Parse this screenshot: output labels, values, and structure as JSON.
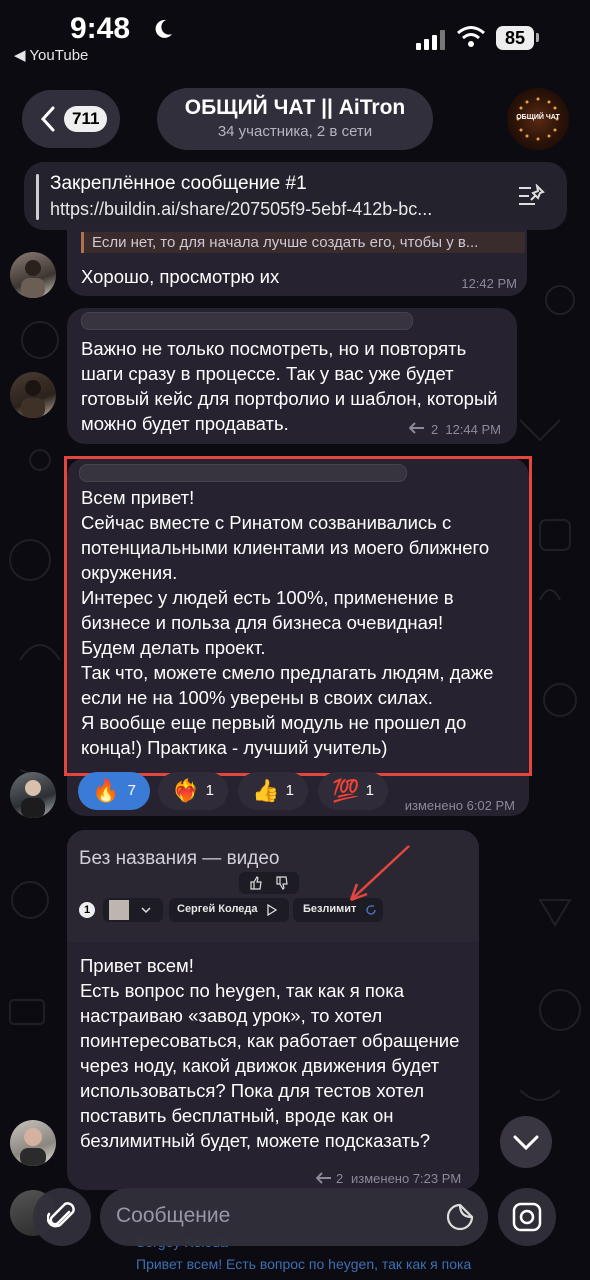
{
  "status_bar": {
    "time": "9:48",
    "back_app": "◀ YouTube",
    "battery": "85"
  },
  "header": {
    "back_count": "711",
    "title": "ОБЩИЙ ЧАТ || AiTron",
    "subtitle": "34 участника, 2 в сети",
    "avatar_text": "ОБЩИЙ ЧАТ"
  },
  "pinned": {
    "title": "Закреплённое сообщение #1",
    "text": "https://buildin.ai/share/207505f9-5ebf-412b-bc..."
  },
  "messages": [
    {
      "quote": "Если нет, то для начала лучше создать его, чтобы у в...",
      "text": "Хорошо, просмотрю их",
      "time": "12:42 PM"
    },
    {
      "text": "Важно не только посмотреть, но и повторять шаги сразу в процессе. Так у вас уже будет готовый кейс для портфолио и шаблон, который можно будет продавать.",
      "replies": "2",
      "time": "12:44 PM"
    },
    {
      "text": "Всем привет!\nСейчас вместе с Ринатом созванивались с потенциальными клиентами из моего ближнего окружения.\nИнтерес у людей есть 100%, применение в бизнесе и польза для бизнеса очевидная!\nБудем делать проект.\nТак что, можете смело предлагать людям, даже если не на 100% уверены в своих силах.\nЯ вообще еще первый модуль не прошел до конца!) Практика - лучший учитель)",
      "time": "изменено 6:02 PM",
      "reactions": [
        {
          "emoji": "🔥",
          "count": "7"
        },
        {
          "emoji": "❤️‍🔥",
          "count": "1"
        },
        {
          "emoji": "👍",
          "count": "1"
        },
        {
          "emoji": "💯",
          "count": "1"
        }
      ]
    },
    {
      "video_title": "Без названия — видео",
      "video_user": "Сергей Коледа",
      "video_plan": "Безлимит",
      "video_num": "1",
      "text": "Привет всем!\nЕсть вопрос по heygen, так как я пока настраиваю «завод урок», то хотел поинтересоваться, как работает обращение через ноду, какой движок движения будет использоваться? Пока для тестов хотел поставить бесплатный, вроде как он безлимитный будет, можете подсказать?",
      "replies": "2",
      "time": "изменено 7:23 PM"
    }
  ],
  "bottom_preview": {
    "name": "Sergey Koleda",
    "text": "Привет всем! Есть вопрос по heygen, так как я пока"
  },
  "input": {
    "placeholder": "Сообщение"
  }
}
